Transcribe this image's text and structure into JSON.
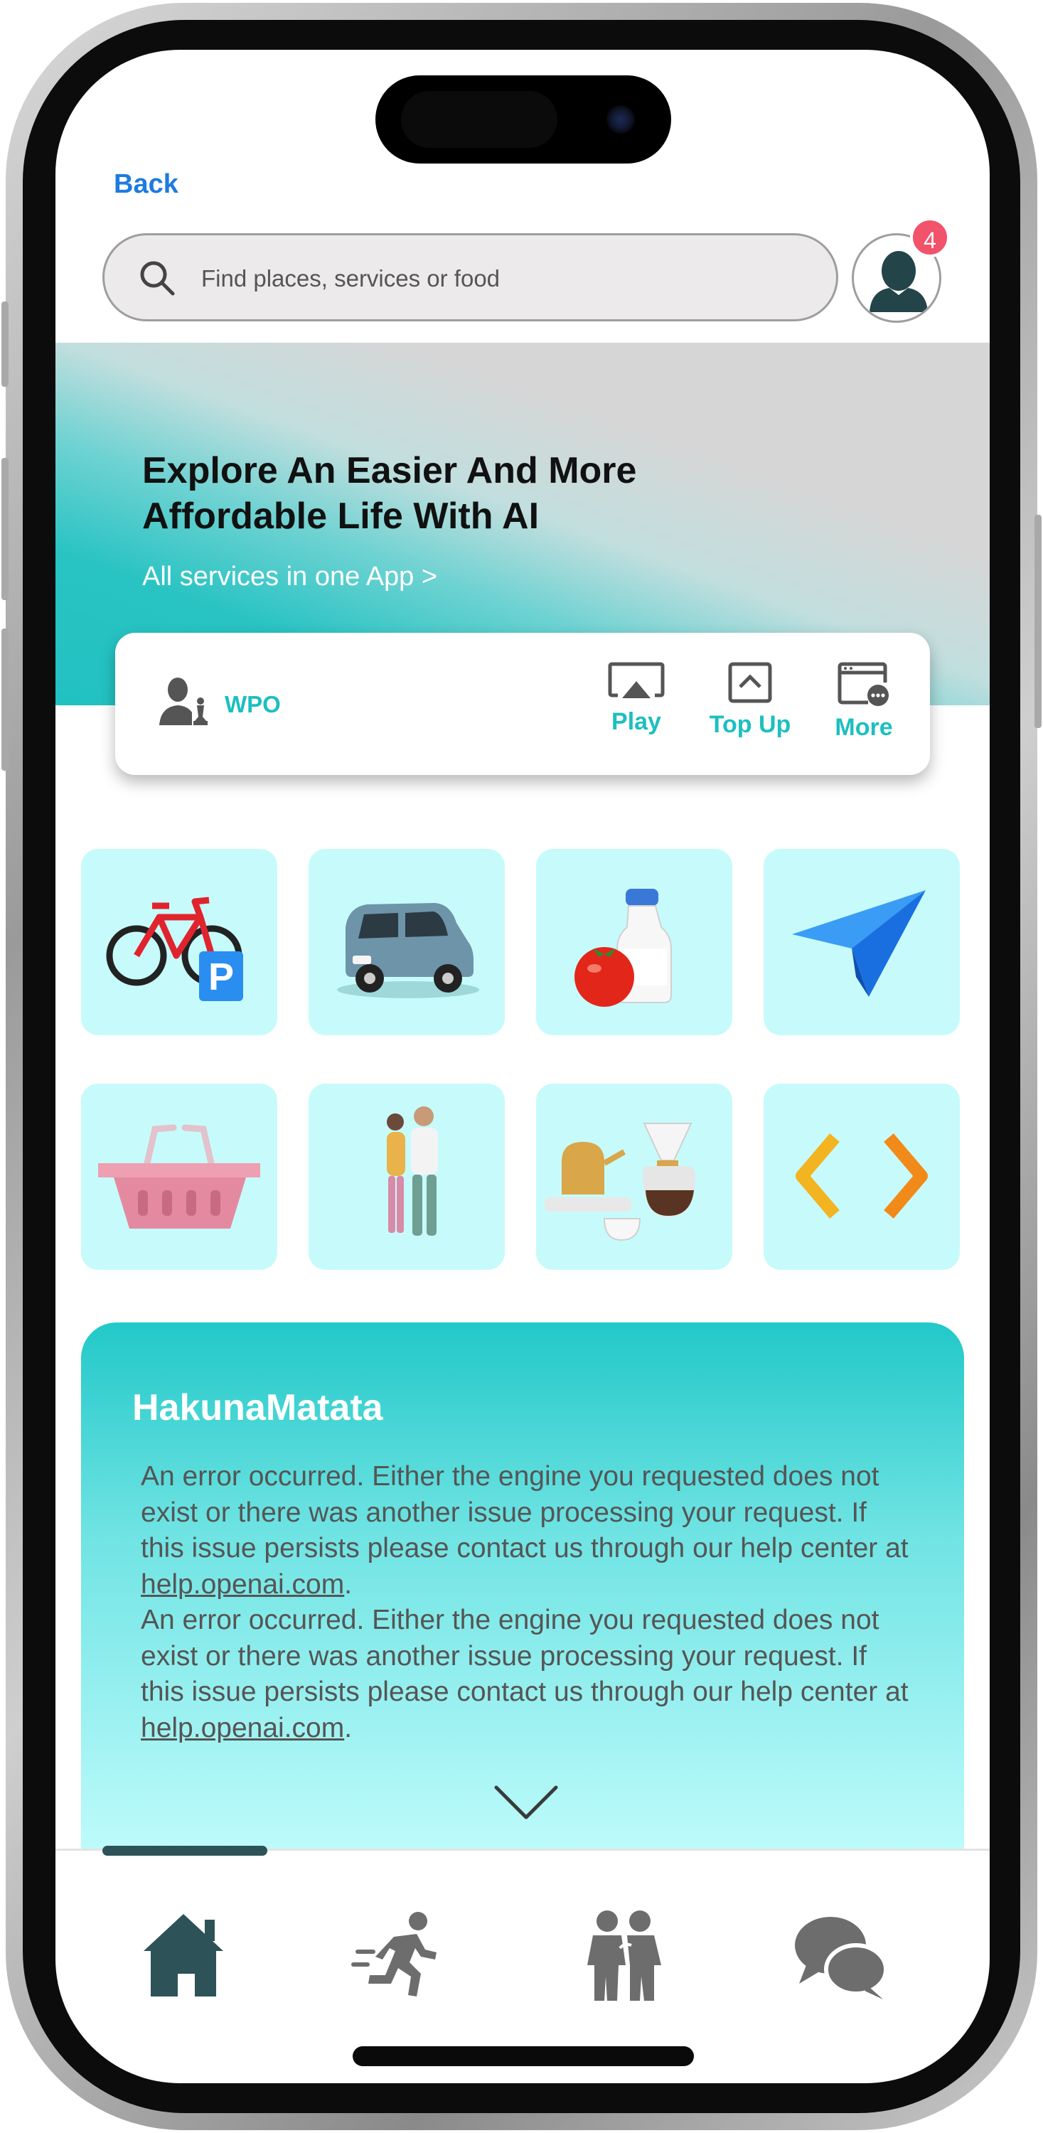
{
  "header": {
    "back_label": "Back",
    "search_placeholder": "Find places, services or food",
    "notification_count": "4"
  },
  "hero": {
    "title": "Explore An Easier And More Affordable Life With AI",
    "subtitle": "All services in one App >"
  },
  "quick_card": {
    "brand_label": "WPO",
    "actions": [
      {
        "label": "Play",
        "icon": "airplay-icon"
      },
      {
        "label": "Top Up",
        "icon": "top-up-icon"
      },
      {
        "label": "More",
        "icon": "more-window-icon"
      }
    ]
  },
  "services": [
    {
      "icon": "bicycle-parking-icon"
    },
    {
      "icon": "car-icon"
    },
    {
      "icon": "groceries-icon"
    },
    {
      "icon": "paper-plane-icon"
    },
    {
      "icon": "shopping-basket-icon"
    },
    {
      "icon": "family-icon"
    },
    {
      "icon": "coffee-icon"
    },
    {
      "icon": "code-brackets-icon"
    }
  ],
  "info_card": {
    "title": "HakunaMatata",
    "paragraph_1_text": "An error occurred. Either the engine you requested does not exist or there was another issue processing your request. If this issue persists please contact us through our help center at ",
    "paragraph_1_link": "help.openai.com",
    "paragraph_2_text": "An error occurred. Either the engine you requested does not exist or there was another issue processing your request. If this issue persists please contact us through our help center at ",
    "paragraph_2_link": "help.openai.com",
    "period": "."
  },
  "bottom_nav": [
    {
      "icon": "home-icon",
      "active": true
    },
    {
      "icon": "running-icon",
      "active": false
    },
    {
      "icon": "people-icon",
      "active": false
    },
    {
      "icon": "chat-icon",
      "active": false
    }
  ],
  "colors": {
    "accent": "#1dbfbf",
    "link_blue": "#1d7be0",
    "badge": "#f2526a",
    "tile_bg": "#c7fbfb",
    "nav_active": "#2d5257",
    "nav_inactive": "#6d6d6d"
  }
}
